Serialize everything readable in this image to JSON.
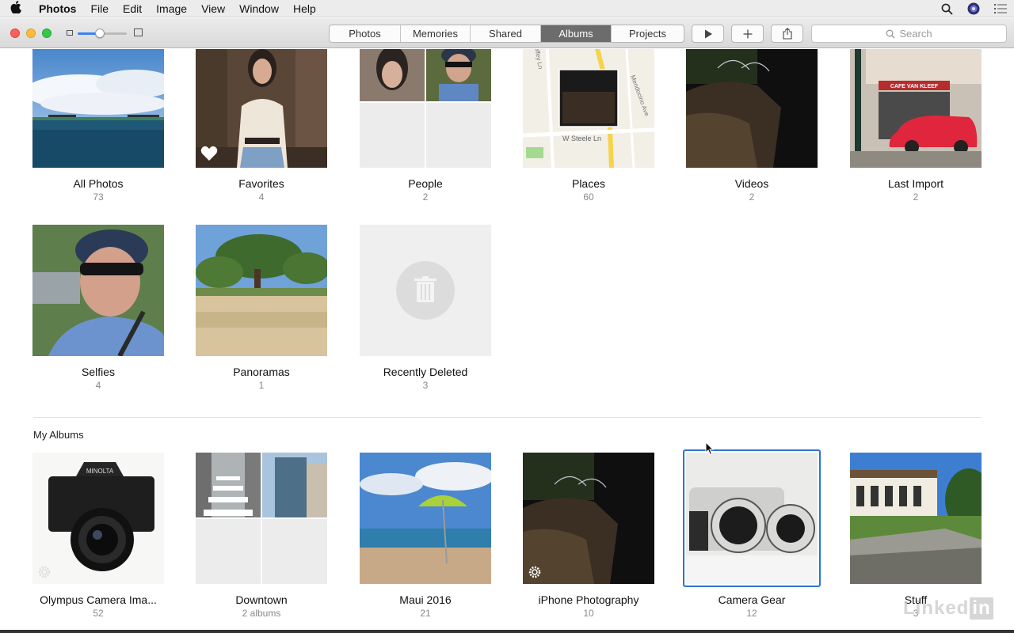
{
  "menubar": {
    "app": "Photos",
    "items": [
      "File",
      "Edit",
      "Image",
      "View",
      "Window",
      "Help"
    ]
  },
  "toolbar": {
    "tabs": [
      "Photos",
      "Memories",
      "Shared",
      "Albums",
      "Projects"
    ],
    "active_tab": "Albums",
    "search_placeholder": "Search",
    "zoom_level": 0.45
  },
  "smart_albums": [
    {
      "title": "All Photos",
      "count": "73"
    },
    {
      "title": "Favorites",
      "count": "4"
    },
    {
      "title": "People",
      "count": "2"
    },
    {
      "title": "Places",
      "count": "60"
    },
    {
      "title": "Videos",
      "count": "2"
    },
    {
      "title": "Last Import",
      "count": "2"
    },
    {
      "title": "Selfies",
      "count": "4"
    },
    {
      "title": "Panoramas",
      "count": "1"
    },
    {
      "title": "Recently Deleted",
      "count": "3"
    }
  ],
  "map_labels": {
    "street1": "W Steele Ln",
    "street2": "Mendocino Ave",
    "street3": "Coffey Ln"
  },
  "photo_text": {
    "cafe_sign": "CAFE VAN KLEEF",
    "camera_brand": "MINOLTA"
  },
  "my_albums": {
    "title": "My Albums",
    "items": [
      {
        "title": "Olympus Camera Ima...",
        "count": "52"
      },
      {
        "title": "Downtown",
        "count": "2 albums"
      },
      {
        "title": "Maui 2016",
        "count": "21"
      },
      {
        "title": "iPhone Photography",
        "count": "10"
      },
      {
        "title": "Camera Gear",
        "count": "12"
      },
      {
        "title": "Stuff",
        "count": "3"
      }
    ],
    "selected": "Camera Gear"
  },
  "watermark": {
    "text": "Linked",
    "box": "in"
  }
}
